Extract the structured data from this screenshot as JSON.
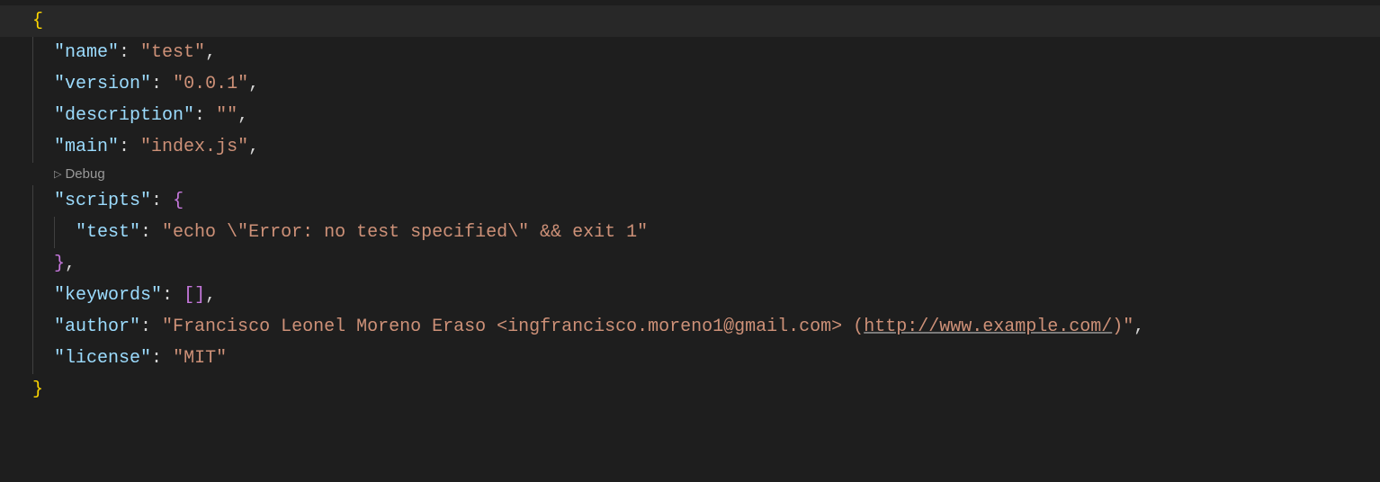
{
  "codelens": {
    "debug_label": "Debug",
    "triangle": "▷"
  },
  "json": {
    "name_key": "\"name\"",
    "name_val": "\"test\"",
    "version_key": "\"version\"",
    "version_val": "\"0.0.1\"",
    "description_key": "\"description\"",
    "description_val": "\"\"",
    "main_key": "\"main\"",
    "main_val": "\"index.js\"",
    "scripts_key": "\"scripts\"",
    "test_key": "\"test\"",
    "test_val": "\"echo \\\"Error: no test specified\\\" && exit 1\"",
    "keywords_key": "\"keywords\"",
    "keywords_val": "[]",
    "author_key": "\"author\"",
    "author_val_pre": "\"Francisco Leonel Moreno Eraso <ingfrancisco.moreno1@gmail.com> (",
    "author_url": "http://www.example.com/",
    "author_val_post": ")\"",
    "license_key": "\"license\"",
    "license_val": "\"MIT\""
  },
  "tokens": {
    "colon": ":",
    "space": " ",
    "comma": ",",
    "lbrace": "{",
    "rbrace": "}"
  }
}
